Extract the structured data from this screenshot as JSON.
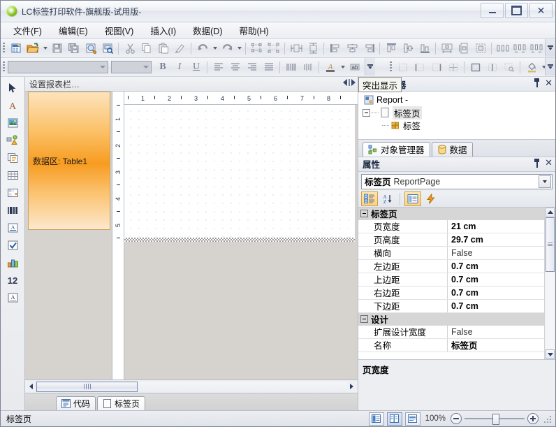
{
  "window": {
    "title": "LC标签打印软件-旗舰版-试用版-",
    "icon": "app-logo-icon",
    "minimize": "—",
    "maximize": "□",
    "close": "✕"
  },
  "menubar": {
    "items": [
      {
        "label": "文件(F)",
        "name": "menu-file"
      },
      {
        "label": "编辑(E)",
        "name": "menu-edit"
      },
      {
        "label": "视图(V)",
        "name": "menu-view"
      },
      {
        "label": "插入(I)",
        "name": "menu-insert"
      },
      {
        "label": "数据(D)",
        "name": "menu-data"
      },
      {
        "label": "帮助(H)",
        "name": "menu-help"
      }
    ]
  },
  "toolbar_main": {
    "buttons": [
      "new-report-icon",
      "open-report-icon",
      "open-dropdown-icon",
      "save-icon",
      "save-all-icon",
      "preview-icon",
      "page-setup-icon",
      "cut-icon",
      "copy-icon",
      "paste-icon",
      "format-painter-icon",
      "undo-icon",
      "undo-dropdown-icon",
      "redo-icon",
      "redo-dropdown-icon",
      "group-icon",
      "ungroup-icon",
      "size-width-icon",
      "size-height-icon",
      "align-left-icon",
      "align-center-h-icon",
      "align-right-icon",
      "align-top-icon",
      "align-middle-icon",
      "align-bottom-icon",
      "center-page-h-icon",
      "center-page-v-icon",
      "fit-icon",
      "space-equal-h-icon",
      "space-inc-h-icon",
      "space-dec-h-icon"
    ]
  },
  "toolbar_format": {
    "font_name": "",
    "font_size": "",
    "bold_label": "B",
    "italic_label": "I",
    "underline_label": "U",
    "buttons": [
      "align-text-left-icon",
      "align-text-center-icon",
      "align-text-right-icon",
      "align-text-justify-icon",
      "text-rotate-icon",
      "text-spacing-icon",
      "font-color-icon",
      "font-color-dropdown-icon",
      "highlight-icon",
      "reset-style-icon",
      "border-none-icon",
      "border-left-icon",
      "border-right-icon",
      "border-all-icon",
      "border-outline-icon",
      "border-inside-icon",
      "border-settings-icon",
      "fill-color-icon",
      "fill-color-dropdown-icon"
    ]
  },
  "toolbox": {
    "items": [
      {
        "name": "tool-select",
        "icon": "pointer-icon"
      },
      {
        "name": "tool-text",
        "icon": "text-a-icon"
      },
      {
        "name": "tool-image",
        "icon": "image-icon"
      },
      {
        "name": "tool-shape",
        "icon": "shape-icon"
      },
      {
        "name": "tool-subreport",
        "icon": "subreport-icon"
      },
      {
        "name": "tool-table",
        "icon": "table-icon"
      },
      {
        "name": "tool-matrix",
        "icon": "matrix-icon"
      },
      {
        "name": "tool-barcode",
        "icon": "barcode-icon"
      },
      {
        "name": "tool-richtext",
        "icon": "richtext-icon"
      },
      {
        "name": "tool-checkbox",
        "icon": "checkbox-icon"
      },
      {
        "name": "tool-chart",
        "icon": "chart-icon"
      },
      {
        "name": "tool-pagenumber",
        "icon": "number-12-icon"
      },
      {
        "name": "tool-label-text",
        "icon": "label-text-icon"
      }
    ]
  },
  "designer": {
    "band_header_label": "设置报表栏…",
    "band_label": "数据区: Table1",
    "ruler_h_ticks": [
      "1",
      "2",
      "3",
      "4",
      "5",
      "6",
      "7",
      "8"
    ],
    "ruler_v_ticks": [
      "1",
      "2",
      "3",
      "4",
      "5"
    ],
    "tabs": [
      {
        "label": "代码",
        "name": "design-tab-code",
        "icon": "code-icon",
        "active": false
      },
      {
        "label": "标签页",
        "name": "design-tab-labelpage",
        "icon": "page-icon",
        "active": true
      }
    ]
  },
  "object_panel": {
    "title": "对象管理器",
    "tooltip": "突出显示",
    "pin_icon": "pin-icon",
    "close_icon": "close-icon",
    "tree": [
      {
        "label": "Report -",
        "icon": "report-icon",
        "level": 0,
        "selected": false,
        "expander": null
      },
      {
        "label": "标签页",
        "icon": "page-icon",
        "level": 1,
        "selected": true,
        "expander": "minus"
      },
      {
        "label": "标签",
        "icon": "label-icon",
        "level": 2,
        "selected": false,
        "expander": null
      }
    ],
    "tabs": [
      {
        "label": "对象管理器",
        "name": "pane-tab-object-manager",
        "icon": "object-tree-icon",
        "active": true
      },
      {
        "label": "数据",
        "name": "pane-tab-data",
        "icon": "database-icon",
        "active": false
      }
    ]
  },
  "properties_panel": {
    "title": "属性",
    "pin_icon": "pin-icon",
    "close_icon": "close-icon",
    "selector_bold": "标签页",
    "selector_rest": "ReportPage",
    "toolbar": [
      {
        "name": "prop-categorized-button",
        "icon": "categorized-icon",
        "active": true
      },
      {
        "name": "prop-alphabetical-button",
        "icon": "sort-az-icon",
        "active": false
      },
      {
        "name": "prop-properties-button",
        "icon": "properties-icon",
        "active": true
      },
      {
        "name": "prop-events-button",
        "icon": "events-lightning-icon",
        "active": false
      }
    ],
    "groups": [
      {
        "name": "标签页",
        "rows": [
          {
            "name": "页宽度",
            "value": "21 cm",
            "bold": true
          },
          {
            "name": "页高度",
            "value": "29.7 cm",
            "bold": true
          },
          {
            "name": "横向",
            "value": "False",
            "bold": false
          },
          {
            "name": "左边距",
            "value": "0.7 cm",
            "bold": true
          },
          {
            "name": "上边距",
            "value": "0.7 cm",
            "bold": true
          },
          {
            "name": "右边距",
            "value": "0.7 cm",
            "bold": true
          },
          {
            "name": "下边距",
            "value": "0.7 cm",
            "bold": true
          }
        ]
      },
      {
        "name": "设计",
        "rows": [
          {
            "name": "扩展设计宽度",
            "value": "False",
            "bold": false
          },
          {
            "name": "名称",
            "value": "标签页",
            "bold": true
          }
        ]
      }
    ],
    "description_title": "页宽度"
  },
  "statusbar": {
    "text": "标签页",
    "zoom_label": "100%",
    "view_buttons": [
      {
        "name": "view-normal-button",
        "icon": "view-normal-icon",
        "active": false
      },
      {
        "name": "view-page-button",
        "icon": "view-page-icon",
        "active": true
      },
      {
        "name": "view-list-button",
        "icon": "view-list-icon",
        "active": false
      }
    ],
    "zoom_out_icon": "zoom-out-icon",
    "zoom_in_icon": "zoom-in-icon",
    "resize_grip_icon": "resize-grip-icon"
  },
  "colors": {
    "band_orange": "#f79c20",
    "accent_blue": "#2e3d66",
    "highlight_gold": "#fcd083"
  }
}
